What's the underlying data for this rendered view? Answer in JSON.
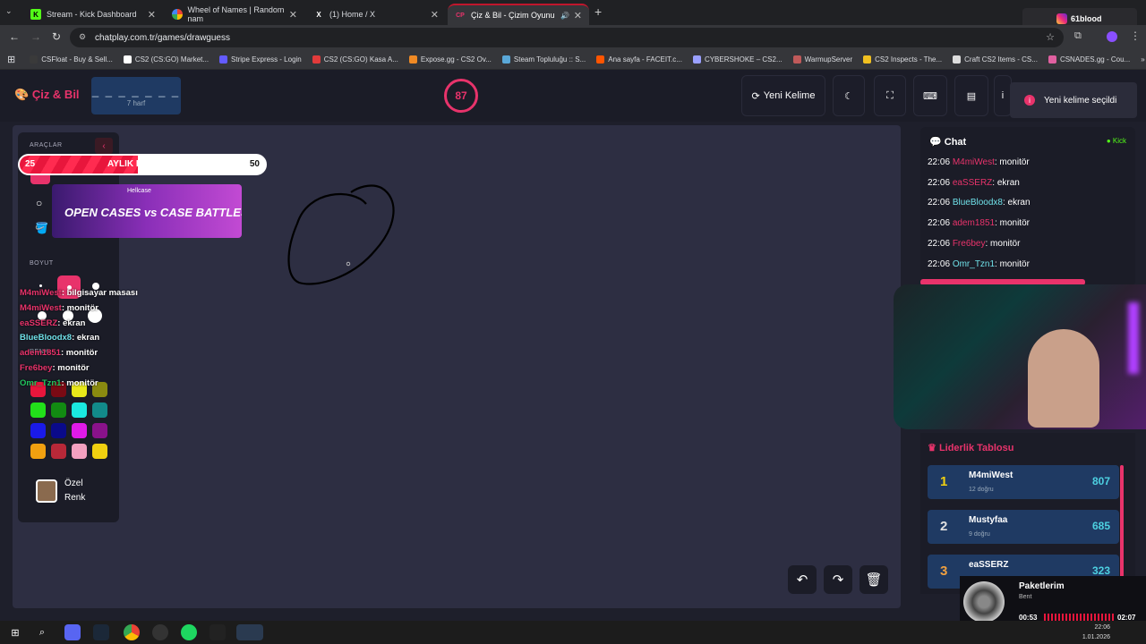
{
  "browser": {
    "tabs": [
      {
        "title": "Stream - Kick Dashboard",
        "icon": "K"
      },
      {
        "title": "Wheel of Names | Random nam",
        "icon": "W"
      },
      {
        "title": "(1) Home / X",
        "icon": "X"
      },
      {
        "title": "Çiz & Bil - Çizim Oyunu",
        "icon": "CP"
      }
    ],
    "new_tab": "+",
    "url": "chatplay.com.tr/games/drawguess",
    "profile_badge": "61blood",
    "bookmarks": [
      "CSFloat - Buy & Sell...",
      "CS2 (CS:GO) Market...",
      "Stripe Express - Login",
      "CS2 (CS:GO) Kasa A...",
      "Expose.gg - CS2 Ov...",
      "Steam Topluluğu :: S...",
      "Ana sayfa - FACEIT.c...",
      "CYBERSHOKE – CS2...",
      "WarmupServer",
      "CS2 Inspects - The...",
      "Craft CS2 Items - CS...",
      "CSNADES.gg - Cou..."
    ]
  },
  "header": {
    "logo": "Çiz & Bil",
    "word_dashes": "_ _ _ _ _ _ _",
    "word_hint": "7 harf",
    "timer": "87",
    "new_word_label": "Yeni Kelime",
    "toast": "Yeni kelime seçildi"
  },
  "tools": {
    "tools_label": "ARAÇLAR",
    "size_label": "BOYUT",
    "color_label": "RENK",
    "custom_color_label_1": "Özel",
    "custom_color_label_2": "Renk",
    "custom_color": "#8a6a4e",
    "swatches": [
      "#e8163c",
      "#7a0a14",
      "#e8e81a",
      "#8a8a10",
      "#22e01a",
      "#128a12",
      "#1ae8e0",
      "#128a8a",
      "#1a1ae8",
      "#0a0a8a",
      "#e01ae8",
      "#8a128a",
      "#f0a010",
      "#b82838",
      "#f4a0c0",
      "#f0d010"
    ]
  },
  "overlay": {
    "goal_start": "25",
    "goal_title": "AYLIK DESTEKS",
    "goal_end": "50",
    "goal_progress": 0.48,
    "banner_brand": "Hellcase",
    "banner_text": "OPEN CASES vs CASE BATTLES",
    "chat": [
      {
        "user": "M4miWest",
        "msg": ": bilgisayar masası",
        "color": "#e8336b"
      },
      {
        "user": "M4miWest",
        "msg": ": monitör",
        "color": "#e8336b"
      },
      {
        "user": "eaSSERZ",
        "msg": ": ekran",
        "color": "#e8336b"
      },
      {
        "user": "BlueBloodx8",
        "msg": ": ekran",
        "color": "#6fe0e8"
      },
      {
        "user": "adem1851",
        "msg": ": monitör",
        "color": "#e8336b"
      },
      {
        "user": "Fre6bey",
        "msg": ": monitör",
        "color": "#e8336b"
      },
      {
        "user": "Omr_Tzn1",
        "msg": ": monitör",
        "color": "#22c55e"
      }
    ]
  },
  "chat": {
    "title": "Chat",
    "platform": "Kick",
    "messages": [
      {
        "time": "22:06",
        "user": "M4miWest",
        "msg": ": monitör",
        "color": "#e8336b"
      },
      {
        "time": "22:06",
        "user": "eaSSERZ",
        "msg": ": ekran",
        "color": "#e8336b"
      },
      {
        "time": "22:06",
        "user": "BlueBloodx8",
        "msg": ": ekran",
        "color": "#6fe0e8"
      },
      {
        "time": "22:06",
        "user": "adem1851",
        "msg": ": monitör",
        "color": "#e8336b"
      },
      {
        "time": "22:06",
        "user": "Fre6bey",
        "msg": ": monitör",
        "color": "#e8336b"
      },
      {
        "time": "22:06",
        "user": "Omr_Tzn1",
        "msg": ": monitör",
        "color": "#6fe0e8"
      }
    ]
  },
  "leaderboard": {
    "title": "Liderlik Tablosu",
    "rows": [
      {
        "rank": "1",
        "name": "M4miWest",
        "sub": "12 doğru",
        "pts": "807",
        "color": "#f0d010"
      },
      {
        "rank": "2",
        "name": "Mustyfaa",
        "sub": "9 doğru",
        "pts": "685",
        "color": "#e0e0e0"
      },
      {
        "rank": "3",
        "name": "eaSSERZ",
        "sub": "",
        "pts": "323",
        "color": "#f0a040"
      }
    ]
  },
  "music": {
    "title": "Paketlerim",
    "artist": "Bent",
    "elapsed": "00:53",
    "total": "02:07"
  },
  "taskbar": {
    "time": "22:06",
    "date": "1.01.2026"
  }
}
